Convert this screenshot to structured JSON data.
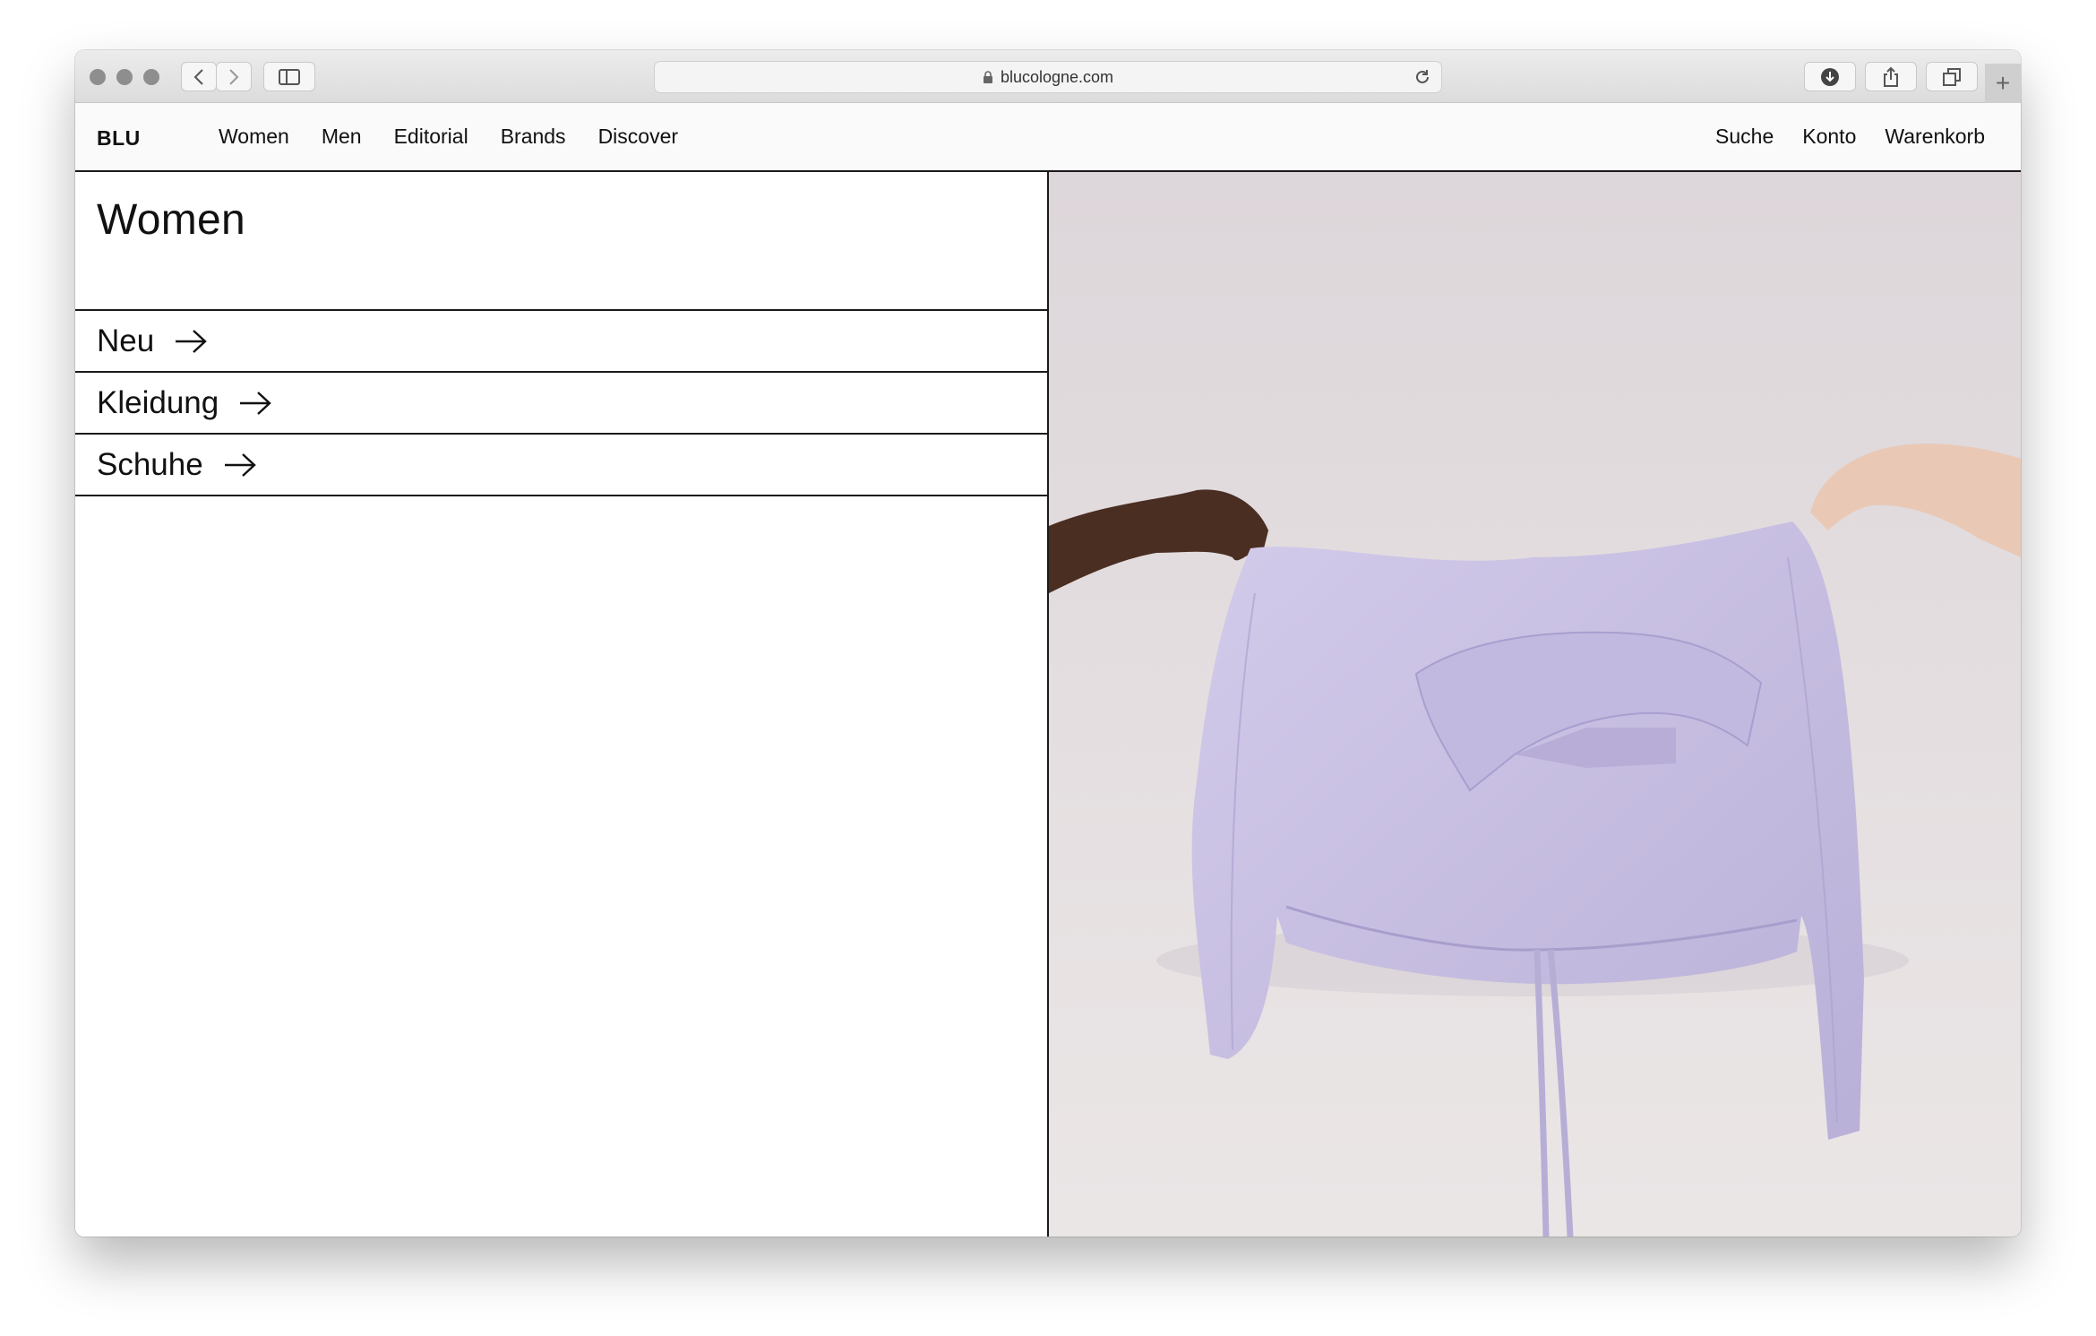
{
  "browser": {
    "url": "blucologne.com",
    "icons": [
      "back-icon",
      "forward-icon",
      "sidebar-icon",
      "lock-icon",
      "reload-icon",
      "download-icon",
      "share-icon",
      "tabs-icon",
      "new-tab-icon"
    ]
  },
  "site": {
    "logo": "BLU",
    "nav_left": [
      "Women",
      "Men",
      "Editorial",
      "Brands",
      "Discover"
    ],
    "nav_right": [
      "Suche",
      "Konto",
      "Warenkorb"
    ]
  },
  "main": {
    "title": "Women",
    "categories": [
      "Neu",
      "Kleidung",
      "Schuhe"
    ]
  },
  "colors": {
    "backdrop": "#e6dfe3",
    "garment": "#c6bddf",
    "border": "#1a1a1a"
  }
}
